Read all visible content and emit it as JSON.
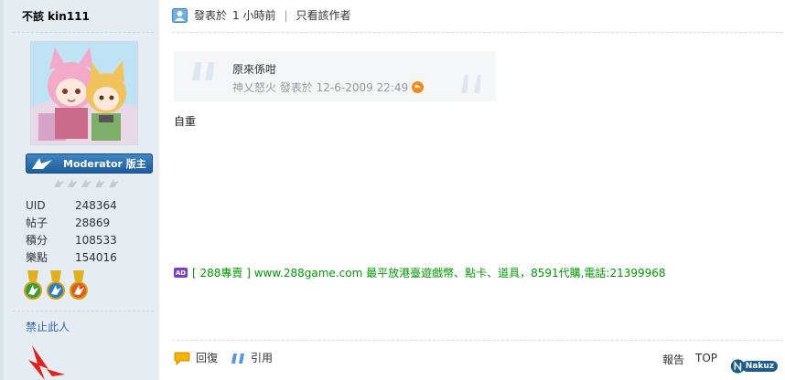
{
  "author": {
    "name": "不該 kin111",
    "rank_label": "Moderator 版主",
    "stars": 5,
    "stats": [
      {
        "key": "UID",
        "value": "248364"
      },
      {
        "key": "帖子",
        "value": "28869"
      },
      {
        "key": "積分",
        "value": "108533"
      },
      {
        "key": "樂點",
        "value": "154016"
      }
    ],
    "medals": [
      "green-medal-icon",
      "blue-medal-icon",
      "orange-medal-icon"
    ],
    "ban_link": "禁止此人"
  },
  "post": {
    "posted_label": "發表於",
    "posted_time": "1 小時前",
    "only_author": "只看該作者",
    "quote": {
      "text": "原來係咁",
      "meta": "神乂怒火 發表於 12-6-2009 22:49"
    },
    "body": "自重",
    "ad": {
      "badge": "AD",
      "text": "[ 288專賣 ] www.288game.com 最平放港臺遊戲幣、點卡、道具，8591代購,電話:21399968"
    }
  },
  "actions": {
    "reply": "回復",
    "quote": "引用",
    "report": "報告",
    "top": "TOP"
  },
  "watermark": "Nakuz",
  "colors": {
    "panel_bg": "#e5edf2",
    "link": "#3366aa",
    "ad_text": "#009900",
    "rank_badge": "#2a6fb0"
  }
}
